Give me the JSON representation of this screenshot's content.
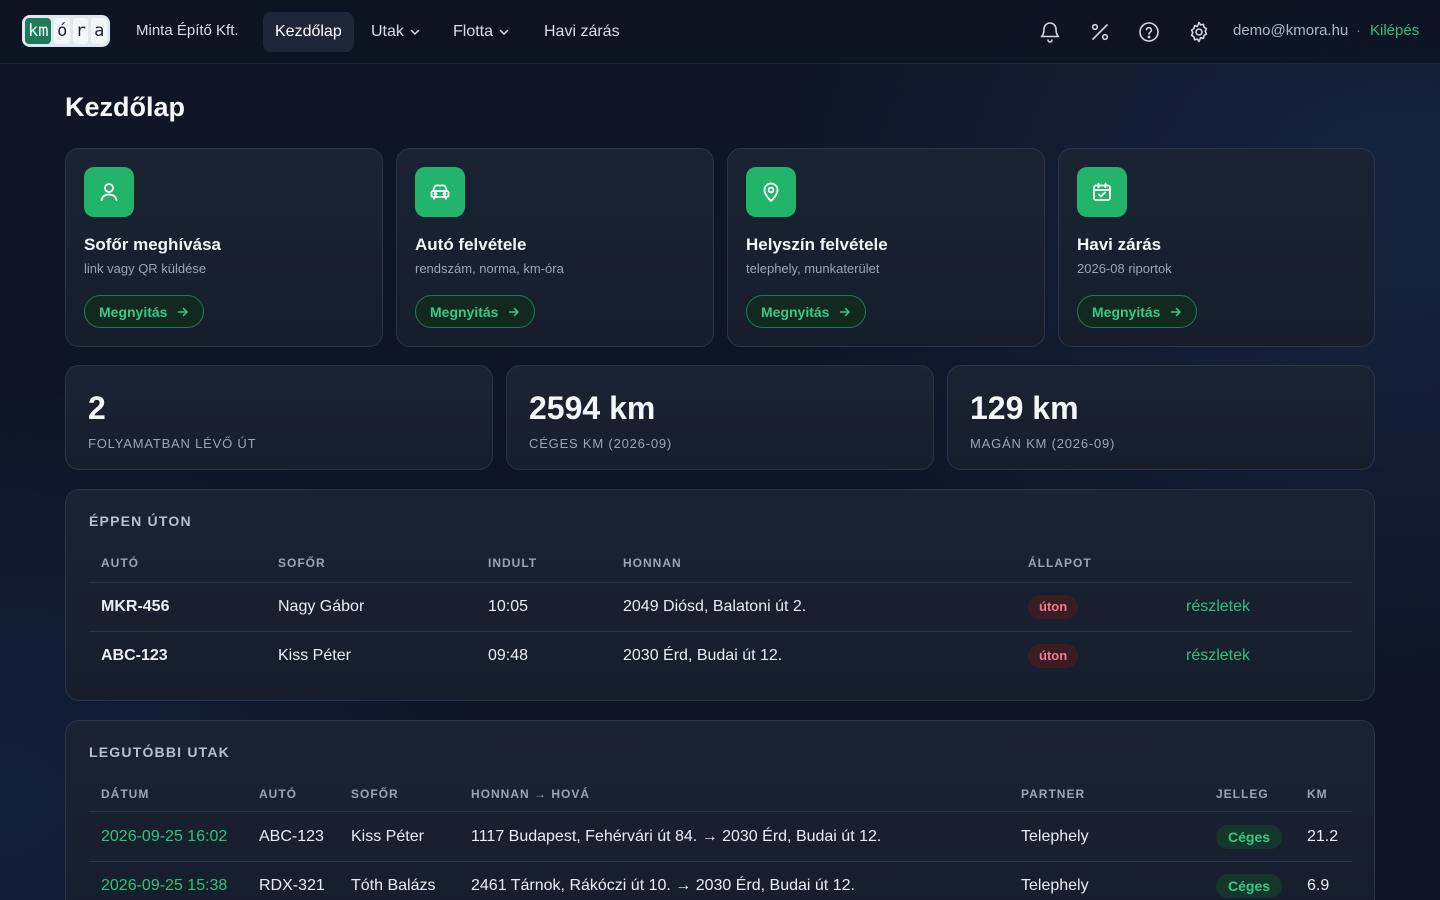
{
  "brand": {
    "logo_km": "km",
    "logo_letters": [
      "ó",
      "r",
      "a"
    ],
    "company": "Minta Építő Kft."
  },
  "nav": {
    "items": [
      {
        "label": "Kezdőlap",
        "active": true
      },
      {
        "label": "Utak",
        "dropdown": true
      },
      {
        "label": "Flotta",
        "dropdown": true
      },
      {
        "label": "Havi zárás"
      }
    ],
    "icons": [
      "bell-icon",
      "percent-icon",
      "help-icon",
      "gear-icon"
    ],
    "user_email": "demo@kmora.hu",
    "separator": "·",
    "logout": "Kilépés"
  },
  "page": {
    "title": "Kezdőlap"
  },
  "actions": [
    {
      "icon": "user-icon",
      "title": "Sofőr meghívása",
      "subtitle": "link vagy QR küldése",
      "button": "Megnyitás"
    },
    {
      "icon": "car-icon",
      "title": "Autó felvétele",
      "subtitle": "rendszám, norma, km-óra",
      "button": "Megnyitás"
    },
    {
      "icon": "map-pin-icon",
      "title": "Helyszín felvétele",
      "subtitle": "telephely, munkaterület",
      "button": "Megnyitás"
    },
    {
      "icon": "calendar-check-icon",
      "title": "Havi zárás",
      "subtitle": "2026-08 riportok",
      "button": "Megnyitás"
    }
  ],
  "stats": [
    {
      "value": "2",
      "label": "FOLYAMATBAN LÉVŐ ÚT"
    },
    {
      "value": "2594 km",
      "label": "CÉGES KM (2026-09)"
    },
    {
      "value": "129 km",
      "label": "MAGÁN KM (2026-09)"
    }
  ],
  "on_road": {
    "title": "ÉPPEN ÚTON",
    "columns": [
      "AUTÓ",
      "SOFŐR",
      "INDULT",
      "HONNAN",
      "ÁLLAPOT"
    ],
    "rows": [
      {
        "car": "MKR-456",
        "driver": "Nagy Gábor",
        "started": "10:05",
        "from": "2049 Diósd, Balatoni út 2.",
        "status": "úton",
        "link": "részletek"
      },
      {
        "car": "ABC-123",
        "driver": "Kiss Péter",
        "started": "09:48",
        "from": "2030 Érd, Budai út 12.",
        "status": "úton",
        "link": "részletek"
      }
    ]
  },
  "recent": {
    "title": "LEGUTÓBBI UTAK",
    "columns": [
      "DÁTUM",
      "AUTÓ",
      "SOFŐR",
      "HONNAN → HOVÁ",
      "PARTNER",
      "JELLEG",
      "KM"
    ],
    "rows": [
      {
        "date": "2026-09-25 16:02",
        "car": "ABC-123",
        "driver": "Kiss Péter",
        "route": "1117 Budapest, Fehérvári út 84. → 2030 Érd, Budai út 12.",
        "partner": "Telephely",
        "type": "Céges",
        "km": "21.2"
      },
      {
        "date": "2026-09-25 15:38",
        "car": "RDX-321",
        "driver": "Tóth Balázs",
        "route": "2461 Tárnok, Rákóczi út 10. → 2030 Érd, Budai út 12.",
        "partner": "Telephely",
        "type": "Céges",
        "km": "6.9"
      }
    ]
  },
  "colors": {
    "accent": "#22b46b",
    "link": "#2fc07d",
    "background": "#0e1626",
    "card": "#1a2333",
    "status_red": "#f07b8b"
  }
}
